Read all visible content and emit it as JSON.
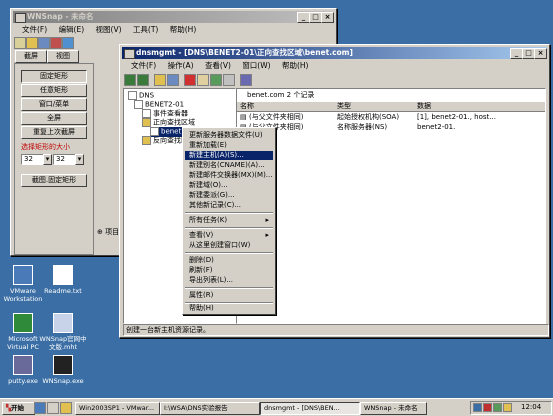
{
  "desktop": {
    "icons": [
      {
        "label_1": "VMware",
        "label_2": "Workstation"
      },
      {
        "label_1": "Readme.txt",
        "label_2": ""
      },
      {
        "label_1": "Microsoft",
        "label_2": "Virtual PC"
      },
      {
        "label_1": "WNSnap官网中",
        "label_2": "文版.mht"
      },
      {
        "label_1": "putty.exe",
        "label_2": ""
      },
      {
        "label_1": "WNSnap.exe",
        "label_2": ""
      }
    ]
  },
  "snap_window": {
    "title": "WNSnap - 未命名",
    "menu": [
      "文件(F)",
      "编辑(E)",
      "视图(V)",
      "工具(T)",
      "帮助(H)"
    ],
    "tabs": [
      "截屏",
      "视图"
    ],
    "buttons": [
      "固定矩形",
      "任意矩形",
      "窗口/菜单",
      "全屏",
      "重复上次截屏",
      "截图.固定矩形"
    ],
    "size_label": "选择矩形的大小",
    "width_value": "32",
    "height_value": "32",
    "side_label": "项目"
  },
  "dns_window": {
    "title": "dnsmgmt - [DNS\\BENET2-01\\正向查找区域\\benet.com]",
    "menu": [
      "文件(F)",
      "操作(A)",
      "查看(V)",
      "窗口(W)",
      "帮助(H)"
    ],
    "tree": [
      "DNS",
      "BENET2-01",
      "事件查看器",
      "正向查找区域",
      "benet.com",
      "反向查找区域"
    ],
    "list_header": "benet.com    2 个记录",
    "columns": [
      "名称",
      "类型",
      "数据"
    ],
    "rows": [
      [
        "(与父文件夹相同)",
        "起始授权机构(SOA)",
        "[1], benet2-01., host..."
      ],
      [
        "(与父文件夹相同)",
        "名称服务器(NS)",
        "benet2-01."
      ]
    ],
    "status": "创建一台新主机资源记录。"
  },
  "context_menu": {
    "items": [
      "更新服务器数据文件(U)",
      "重新加载(E)",
      "新建主机(A)(S)...",
      "新建别名(CNAME)(A)...",
      "新建邮件交换器(MX)(M)...",
      "新建域(O)...",
      "新建委派(G)...",
      "其他新记录(C)...",
      "所有任务(K)",
      "查看(V)",
      "从这里创建窗口(W)",
      "删除(D)",
      "刷新(F)",
      "导出列表(L)...",
      "属性(R)",
      "帮助(H)"
    ],
    "highlighted_index": 2
  },
  "taskbar": {
    "start": "开始",
    "buttons": [
      "Win2003SP1 - VMwar...",
      "I:\\WSA\\DNS实验报告",
      "dnsmgmt - [DNS\\BEN...",
      "WNSnap - 未命名"
    ],
    "clock": "12:04"
  }
}
